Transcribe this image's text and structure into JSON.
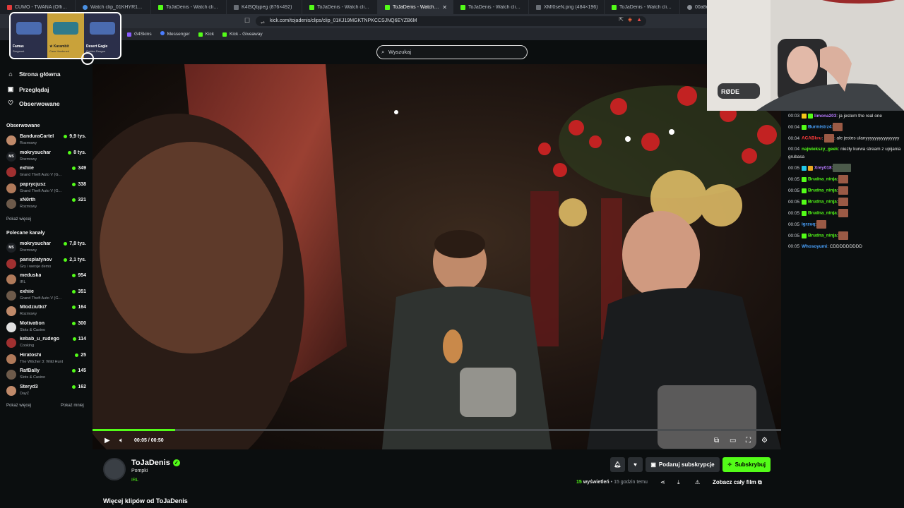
{
  "browser": {
    "tabs": [
      {
        "title": "CUMO - TWANA (Official",
        "icon": "red"
      },
      {
        "title": "Watch clip_01KHYR11VE5HC",
        "icon": "blue"
      },
      {
        "title": "ToJaDenis - Watch clips on Ki",
        "icon": "kick"
      },
      {
        "title": "K4lSQbjpeg (876×492)",
        "icon": "img"
      },
      {
        "title": "ToJaDenis - Watch clips on Ki",
        "icon": "kick"
      },
      {
        "title": "ToJaDenis - Watch clips o",
        "icon": "kick",
        "active": true
      },
      {
        "title": "ToJaDenis - Watch clips on Ki",
        "icon": "kick"
      },
      {
        "title": "XMf0seN.png (484×196)",
        "icon": "img"
      },
      {
        "title": "ToJaDenis - Watch clips on Ki",
        "icon": "kick"
      },
      {
        "title": "00a8ef2",
        "icon": "gray"
      }
    ],
    "url": "kick.com/tojadenis/clips/clip_01KJ19MGKTNPKCCSJNQ6EYZB6M",
    "bookmarks": [
      {
        "label": "G4Skins",
        "icon": "g4"
      },
      {
        "label": "Messenger",
        "icon": "msg"
      },
      {
        "label": "Kick",
        "icon": "kick"
      },
      {
        "label": "Kick - Giveaway",
        "icon": "kick"
      }
    ]
  },
  "header": {
    "search_placeholder": "Wyszukaj"
  },
  "sidebar": {
    "nav": [
      {
        "label": "Strona główna",
        "icon": "home-icon"
      },
      {
        "label": "Przeglądaj",
        "icon": "browse-icon"
      },
      {
        "label": "Obserwowane",
        "icon": "heart-icon"
      }
    ],
    "followed_title": "Obserwowane",
    "followed": [
      {
        "name": "BanduraCartel",
        "category": "Rozmowy",
        "viewers": "9,9 tys."
      },
      {
        "name": "mokrysuchar",
        "category": "Rozmowy",
        "viewers": "8 tys.",
        "initials": "MS"
      },
      {
        "name": "exhiie",
        "category": "Grand Theft Auto V (G...",
        "viewers": "349"
      },
      {
        "name": "paprycjusz",
        "category": "Grand Theft Auto V (G...",
        "viewers": "338"
      },
      {
        "name": "xN0rth",
        "category": "Rozmowy",
        "viewers": "321"
      }
    ],
    "show_more_followed": "Pokaż więcej",
    "recommended_title": "Polecane kanały",
    "recommended": [
      {
        "name": "mokrysuchar",
        "category": "Rozmowy",
        "viewers": "7,8 tys.",
        "initials": "MS"
      },
      {
        "name": "parisplatynov",
        "category": "Gry i wersje demo",
        "viewers": "2,1 tys."
      },
      {
        "name": "meduska",
        "category": "IRL",
        "viewers": "954"
      },
      {
        "name": "exhiie",
        "category": "Grand Theft Auto V (G...",
        "viewers": "351"
      },
      {
        "name": "Mlodziutki7",
        "category": "Rozmowy",
        "viewers": "164"
      },
      {
        "name": "Motivation",
        "category": "Slots & Casino",
        "viewers": "300"
      },
      {
        "name": "kebab_u_rudego",
        "category": "Cooking",
        "viewers": "114"
      },
      {
        "name": "Hiratoshi",
        "category": "The Witcher 3: Wild Hunt",
        "viewers": "25"
      },
      {
        "name": "RafBally",
        "category": "Slots & Casino",
        "viewers": "145"
      },
      {
        "name": "Steryd3",
        "category": "DayZ",
        "viewers": "162"
      }
    ],
    "show_more": "Pokaż więcej",
    "show_less": "Pokaż mniej"
  },
  "player": {
    "time": "00:05 / 00:50",
    "progress_fraction": 0.12
  },
  "clip": {
    "channel": "ToJaDenis",
    "title": "Pompki",
    "category": "IRL",
    "views_count": "15",
    "views_label": "wyświetleń",
    "age": "• 15 godzin temu",
    "gift_sub": "Podaruj subskrypcje",
    "subscribe": "Subskrybuj",
    "full_film": "Zobacz cały film",
    "more_clips": "Więcej klipów od ToJaDenis"
  },
  "chat": [
    {
      "time": "00:03",
      "user": "limona203",
      "color": "#b77aff",
      "text": ": ja jestem the real one",
      "badges": [
        "crown",
        "green"
      ]
    },
    {
      "time": "00:04",
      "user": "Burmistrz4",
      "color": "#4aa3ff",
      "text": ":",
      "badges": [
        "green"
      ],
      "emote": true
    },
    {
      "time": "00:04",
      "user": "ACABkru",
      "color": "#ff3b3b",
      "text": ": ale jestes ulanyyyyyyyyyyyyyyy",
      "emote_mid": true
    },
    {
      "time": "00:04",
      "user": "najwiekszy_geek",
      "color": "#53fc18",
      "text": ": niezły kurwa stream z upijania grubasa"
    },
    {
      "time": "00:05",
      "user": "Xrey018",
      "color": "#b77aff",
      "text": ":",
      "badges": [
        "cyan",
        "gold"
      ],
      "emote_wide": true
    },
    {
      "time": "00:05",
      "user": "Brudna_ninja",
      "color": "#53fc18",
      "text": ":",
      "badges": [
        "green"
      ],
      "emote": true
    },
    {
      "time": "00:05",
      "user": "Brudna_ninja",
      "color": "#53fc18",
      "text": ":",
      "badges": [
        "green"
      ],
      "emote": true
    },
    {
      "time": "00:05",
      "user": "Brudna_ninja",
      "color": "#53fc18",
      "text": ":",
      "badges": [
        "green"
      ],
      "emote": true
    },
    {
      "time": "00:05",
      "user": "Brudna_ninja",
      "color": "#53fc18",
      "text": ":",
      "badges": [
        "green"
      ],
      "emote": true
    },
    {
      "time": "00:05",
      "user": "igrzuq",
      "color": "#4aa3ff",
      "text": ":",
      "emote": true
    },
    {
      "time": "00:05",
      "user": "Brudna_ninja",
      "color": "#53fc18",
      "text": ":",
      "badges": [
        "green"
      ],
      "emote": true
    },
    {
      "time": "00:05",
      "user": "Whosoyumi",
      "color": "#4aa3ff",
      "text": ": CDDDDDDDDD"
    }
  ],
  "overlay": {
    "items": [
      {
        "name": "Famas",
        "sub": "Sergeant"
      },
      {
        "name": "★ Karambit",
        "sub": "Case Hardened"
      },
      {
        "name": "Desert Eagle",
        "sub": "Golden Dragon"
      }
    ]
  },
  "colors": {
    "kick_green": "#53fc18",
    "background": "#0b0e0f",
    "button_dark": "#2b2f33"
  }
}
